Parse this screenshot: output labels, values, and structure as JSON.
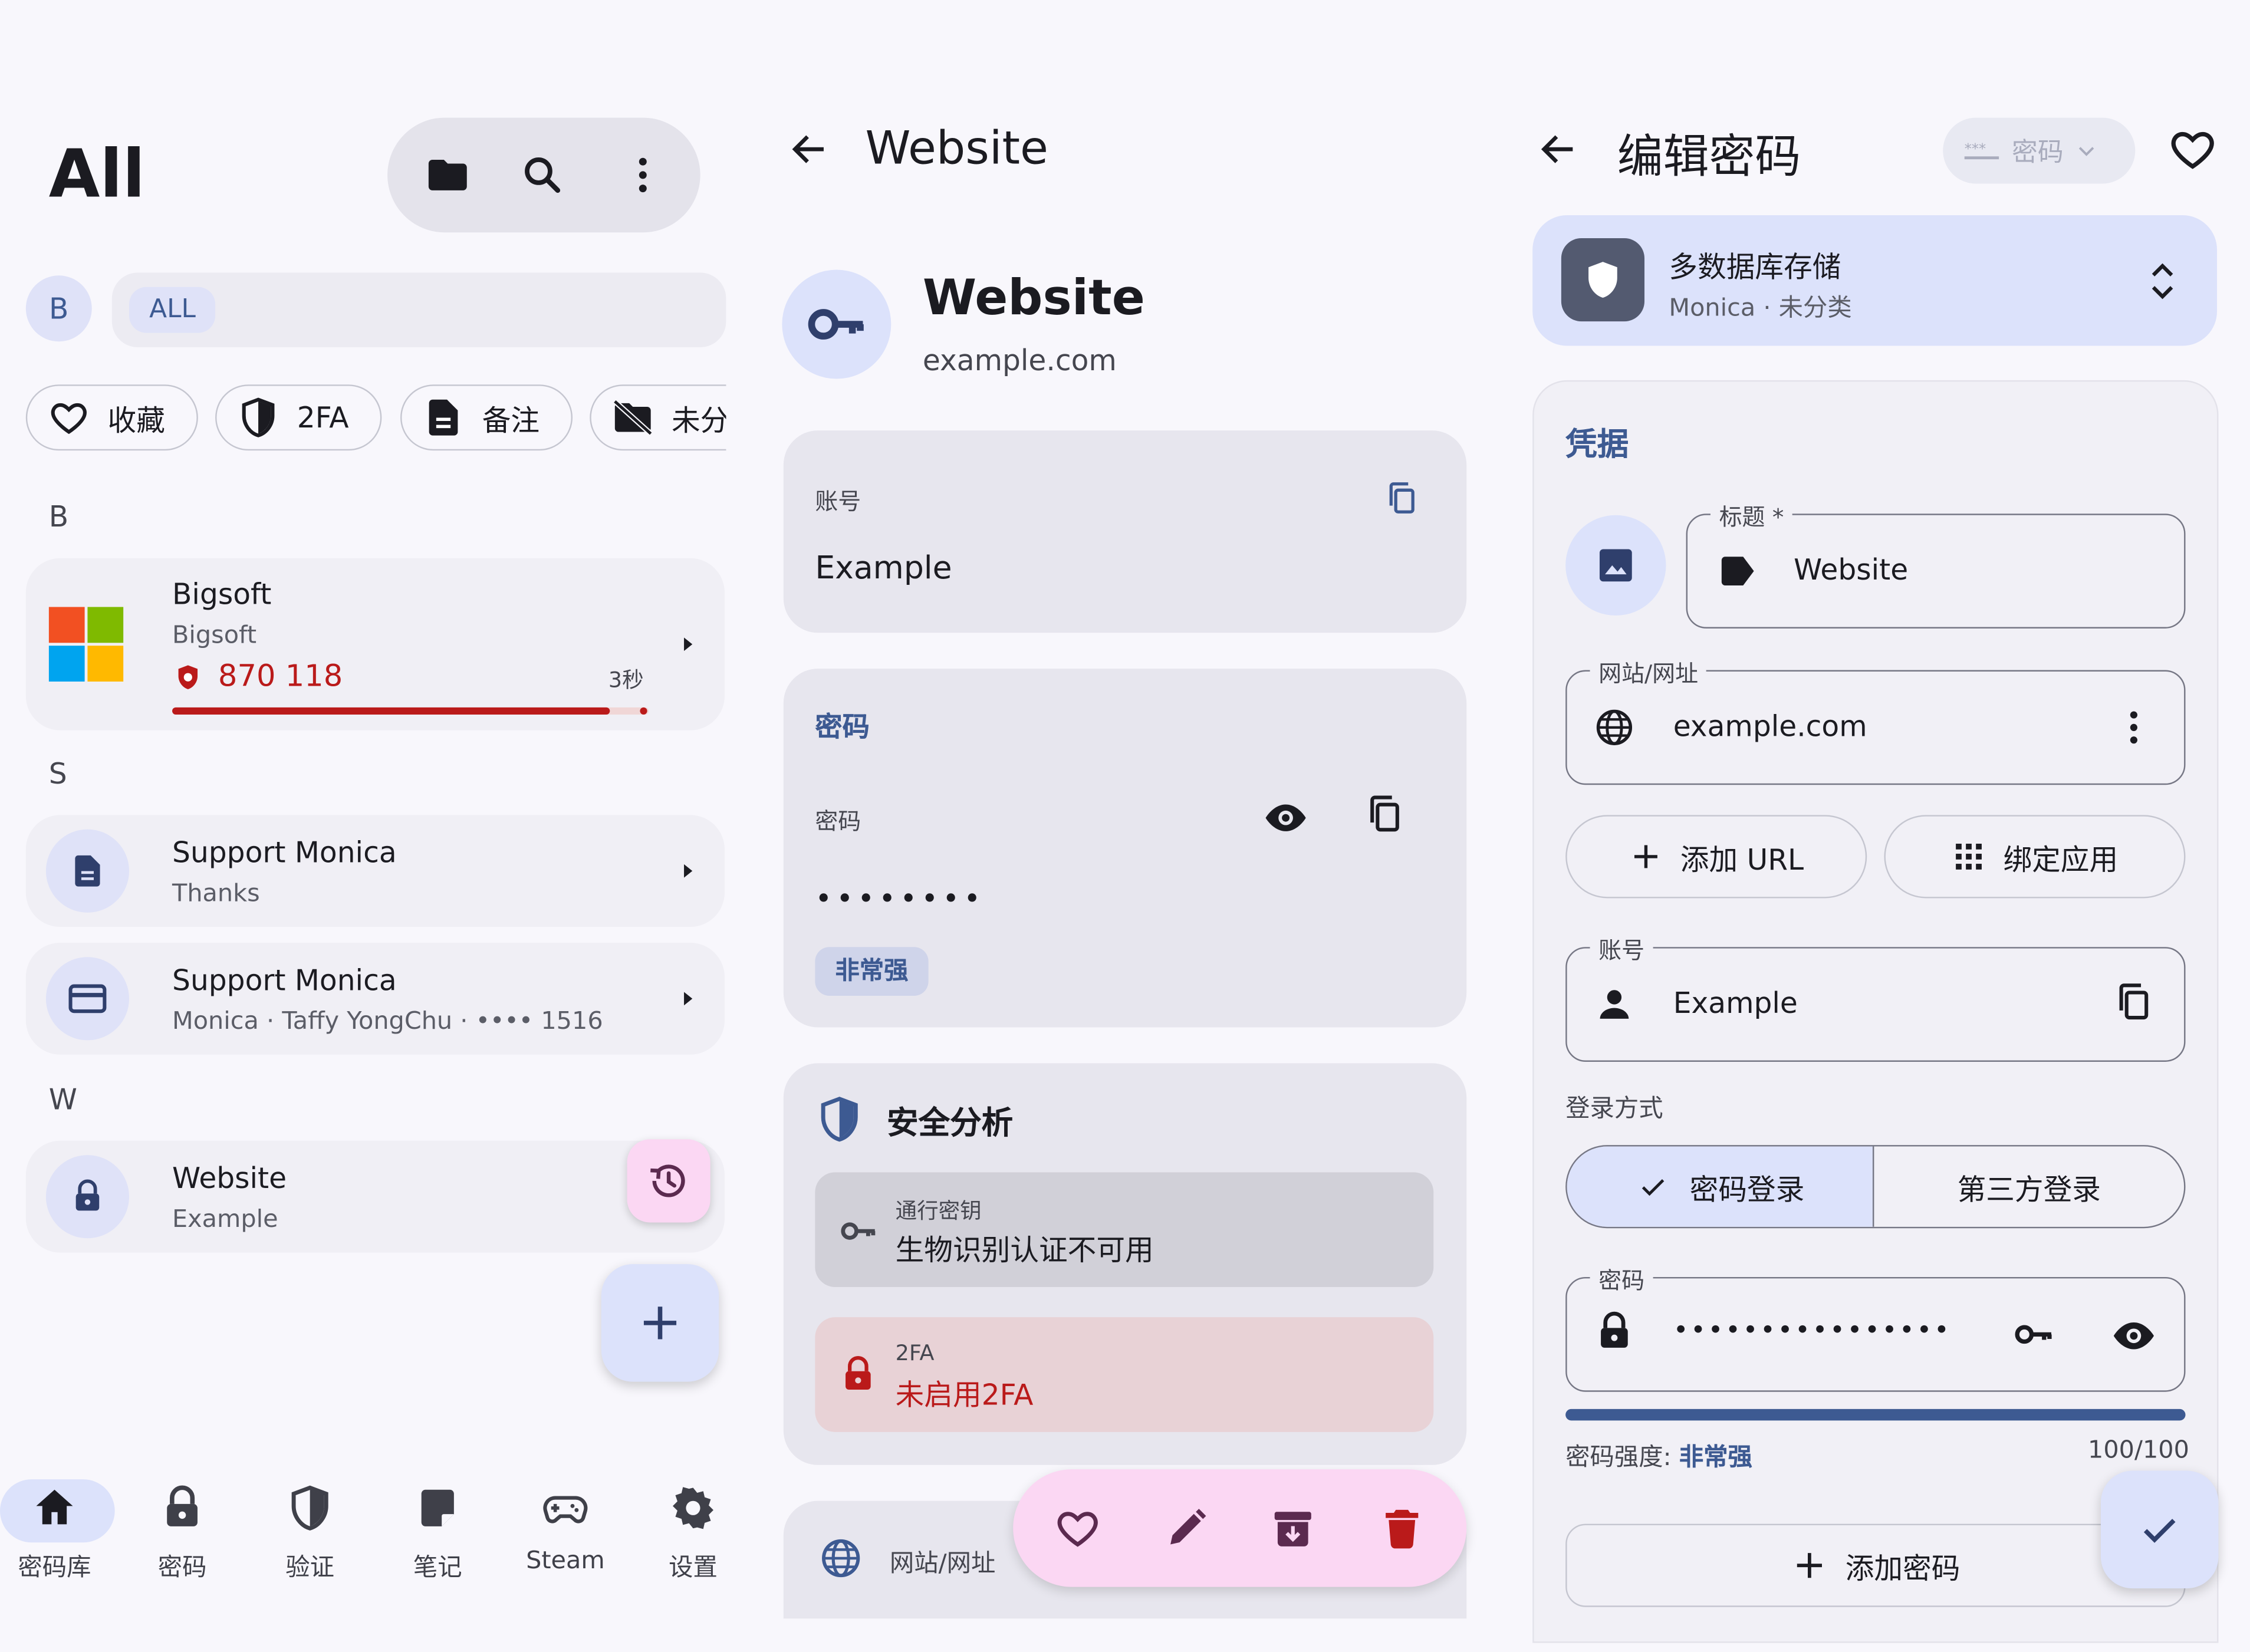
{
  "panel1": {
    "title": "All",
    "account_badge": "B",
    "filter_tag": "ALL",
    "chips": [
      {
        "label": "收藏",
        "icon": "heart-icon"
      },
      {
        "label": "2FA",
        "icon": "shield-icon"
      },
      {
        "label": "备注",
        "icon": "note-icon"
      },
      {
        "label": "未分",
        "icon": "folder-off-icon"
      }
    ],
    "sections": {
      "b": "B",
      "s": "S",
      "w": "W"
    },
    "items": [
      {
        "title": "Bigsoft",
        "subtitle": "Bigsoft",
        "otp": "870 118",
        "timer": "3秒",
        "otp_progress": 0.92
      },
      {
        "title": "Support Monica",
        "subtitle": "Thanks"
      },
      {
        "title": "Support Monica",
        "subtitle": "Monica · Taffy YongChu · •••• 1516"
      },
      {
        "title": "Website",
        "subtitle": "Example"
      }
    ],
    "nav": [
      "密码库",
      "密码",
      "验证",
      "笔记",
      "Steam",
      "设置"
    ]
  },
  "panel2": {
    "header_title": "Website",
    "name": "Website",
    "domain": "example.com",
    "account_label": "账号",
    "account_value": "Example",
    "password_section": "密码",
    "password_label": "密码",
    "password_mask": "••••••••",
    "strength_badge": "非常强",
    "security_title": "安全分析",
    "passkey_label": "通行密钥",
    "passkey_value": "生物识别认证不可用",
    "twofa_label": "2FA",
    "twofa_value": "未启用2FA",
    "website_label": "网站/网址"
  },
  "panel3": {
    "header_title": "编辑密码",
    "type_label": "密码",
    "storage_title": "多数据库存储",
    "storage_sub": "Monica · 未分类",
    "section_title": "凭据",
    "title_label": "标题 *",
    "title_value": "Website",
    "website_label": "网站/网址",
    "website_value": "example.com",
    "add_url": "添加 URL",
    "bind_app": "绑定应用",
    "account_label": "账号",
    "account_value": "Example",
    "login_method": "登录方式",
    "login_password": "密码登录",
    "login_third": "第三方登录",
    "password_label": "密码",
    "password_mask": "••••••••••••••••",
    "strength_prefix": "密码强度:",
    "strength_value": "非常强",
    "strength_score": "100/100",
    "strength_fraction": 1.0,
    "add_password": "添加密码"
  },
  "colors": {
    "accent": "#3d5a92",
    "danger": "#ba1a1a",
    "pink": "#fbd7f3",
    "card": "#e7e6ee"
  }
}
